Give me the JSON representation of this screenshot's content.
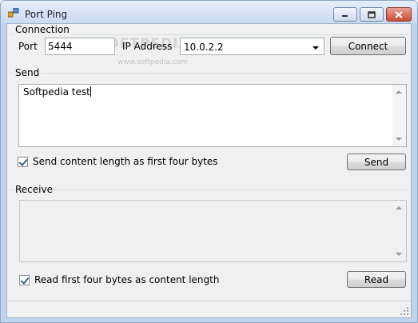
{
  "window": {
    "title": "Port Ping",
    "icon": "network-ports-icon"
  },
  "connection": {
    "group_label": "Connection",
    "port_label": "Port",
    "port_value": "5444",
    "ip_label": "IP Address",
    "ip_value": "10.0.2.2",
    "connect_label": "Connect"
  },
  "send": {
    "group_label": "Send",
    "text": "Softpedia test",
    "length_checkbox_label": "Send content length as first four bytes",
    "length_checked": true,
    "send_label": "Send"
  },
  "receive": {
    "group_label": "Receive",
    "text": "",
    "length_checkbox_label": "Read first four bytes as content length",
    "length_checked": true,
    "read_label": "Read"
  },
  "watermark": {
    "logo": "SOFTPEDIA",
    "url": "www.softpedia.com"
  }
}
